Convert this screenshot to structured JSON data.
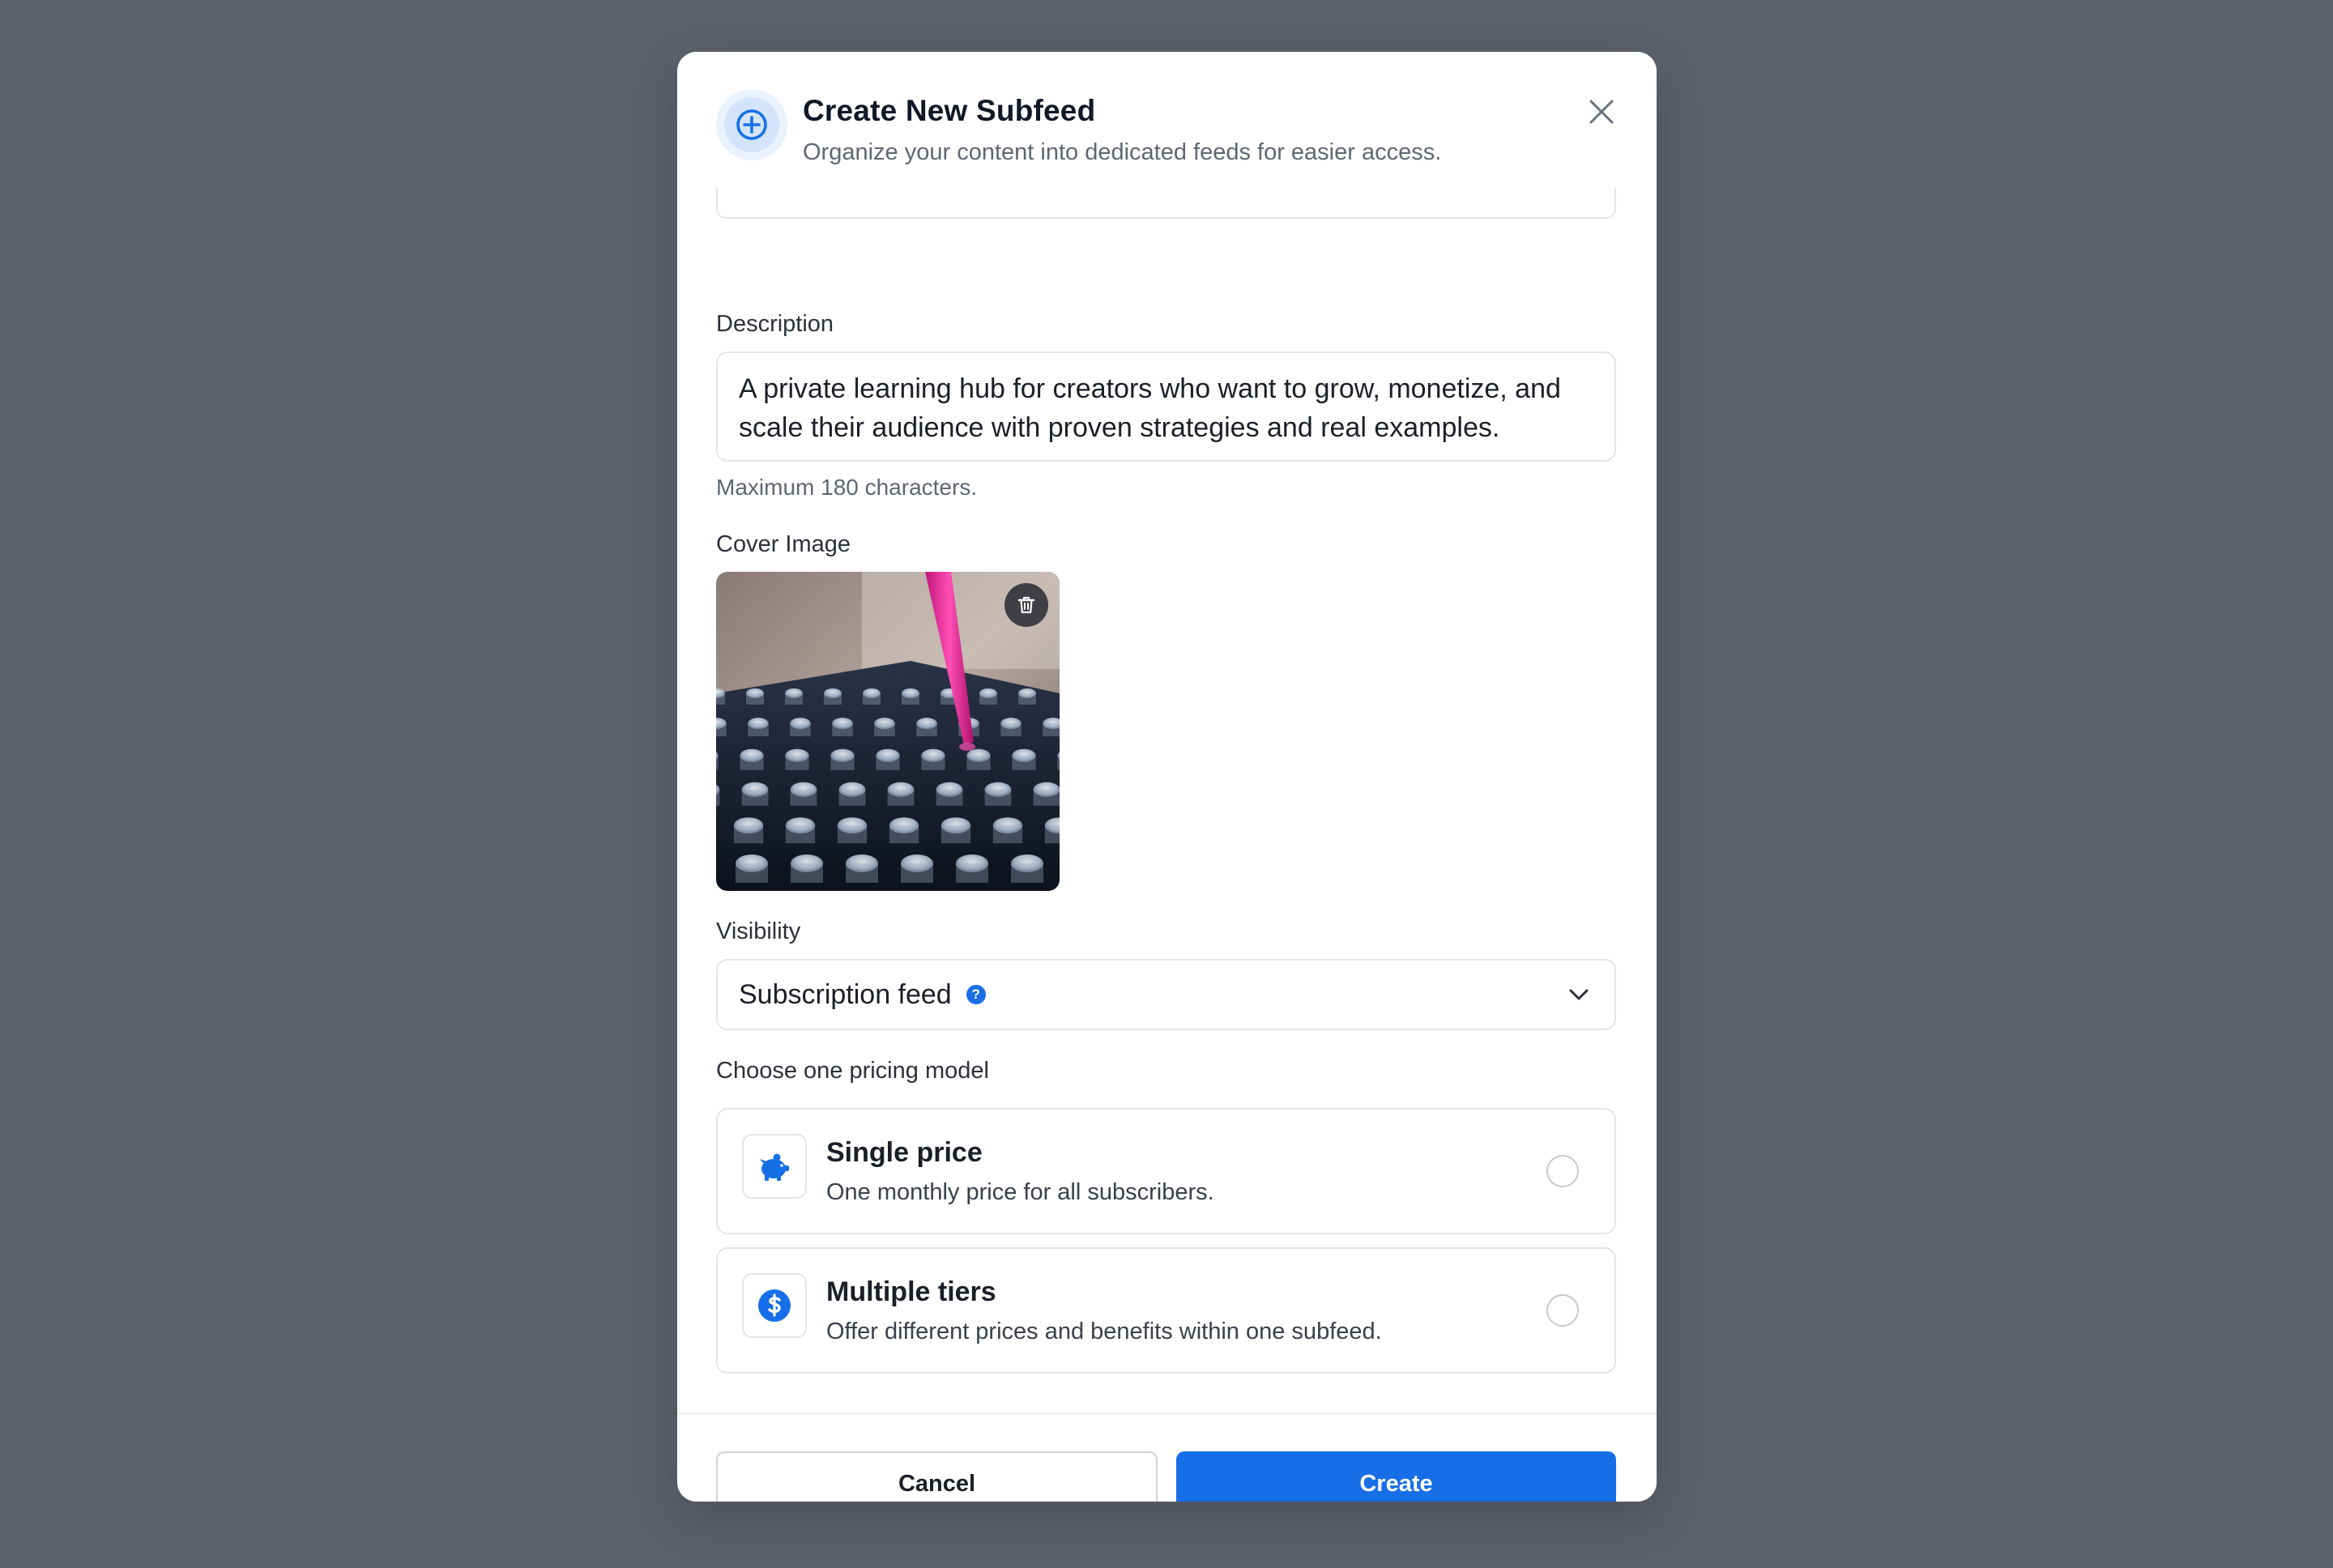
{
  "dialog": {
    "title": "Create New Subfeed",
    "subtitle": "Organize your content into dedicated feeds for easier access.",
    "close_label": "×"
  },
  "description": {
    "label": "Description",
    "value": "A private learning hub for creators who want to grow, monetize, and scale their audience with proven strategies and real examples.",
    "helper": "Maximum 180 characters."
  },
  "cover_image": {
    "label": "Cover Image"
  },
  "visibility": {
    "label": "Visibility",
    "selected": "Subscription feed",
    "help_glyph": "?"
  },
  "pricing": {
    "label": "Choose one pricing model",
    "options": [
      {
        "title": "Single price",
        "description": "One monthly price for all subscribers.",
        "icon": "piggy-bank-icon",
        "selected": false
      },
      {
        "title": "Multiple tiers",
        "description": "Offer different prices and benefits within one subfeed.",
        "icon": "dollar-coin-icon",
        "selected": false
      }
    ]
  },
  "footer": {
    "cancel_label": "Cancel",
    "create_label": "Create"
  },
  "colors": {
    "accent": "#176fe8",
    "backdrop": "#5d616c",
    "border": "#e3e5ea"
  }
}
